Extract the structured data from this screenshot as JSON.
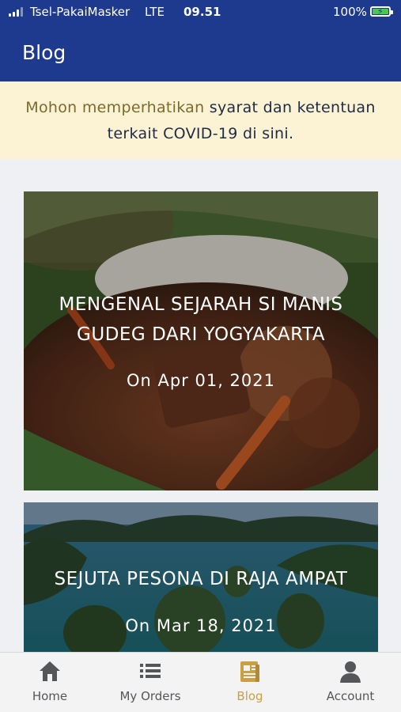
{
  "status_bar": {
    "carrier": "Tsel-PakaiMasker",
    "network": "LTE",
    "time": "09.51",
    "battery": "100%",
    "battery_level": 1.0
  },
  "header": {
    "title": "Blog",
    "background": "#1d3a8f"
  },
  "notice": {
    "link_text": "Mohon memperhatikan",
    "text_rest": " syarat dan ketentuan",
    "line2": "terkait COVID-19 di sini.",
    "background": "#fcf3d5"
  },
  "posts": [
    {
      "title": "MENGENAL SEJARAH SI MANIS GUDEG DARI YOGYAKARTA",
      "date": "On Apr 01, 2021",
      "image": "gudeg-food-photo"
    },
    {
      "title": "SEJUTA PESONA DI RAJA AMPAT",
      "date": "On Mar 18, 2021",
      "image": "raja-ampat-islands-photo"
    }
  ],
  "tab_bar": {
    "tabs": [
      {
        "label": "Home",
        "icon": "home-icon"
      },
      {
        "label": "My Orders",
        "icon": "list-icon"
      },
      {
        "label": "Blog",
        "icon": "blog-icon"
      },
      {
        "label": "Account",
        "icon": "account-icon"
      }
    ],
    "active_index": 2,
    "active_color": "#c9a043"
  }
}
